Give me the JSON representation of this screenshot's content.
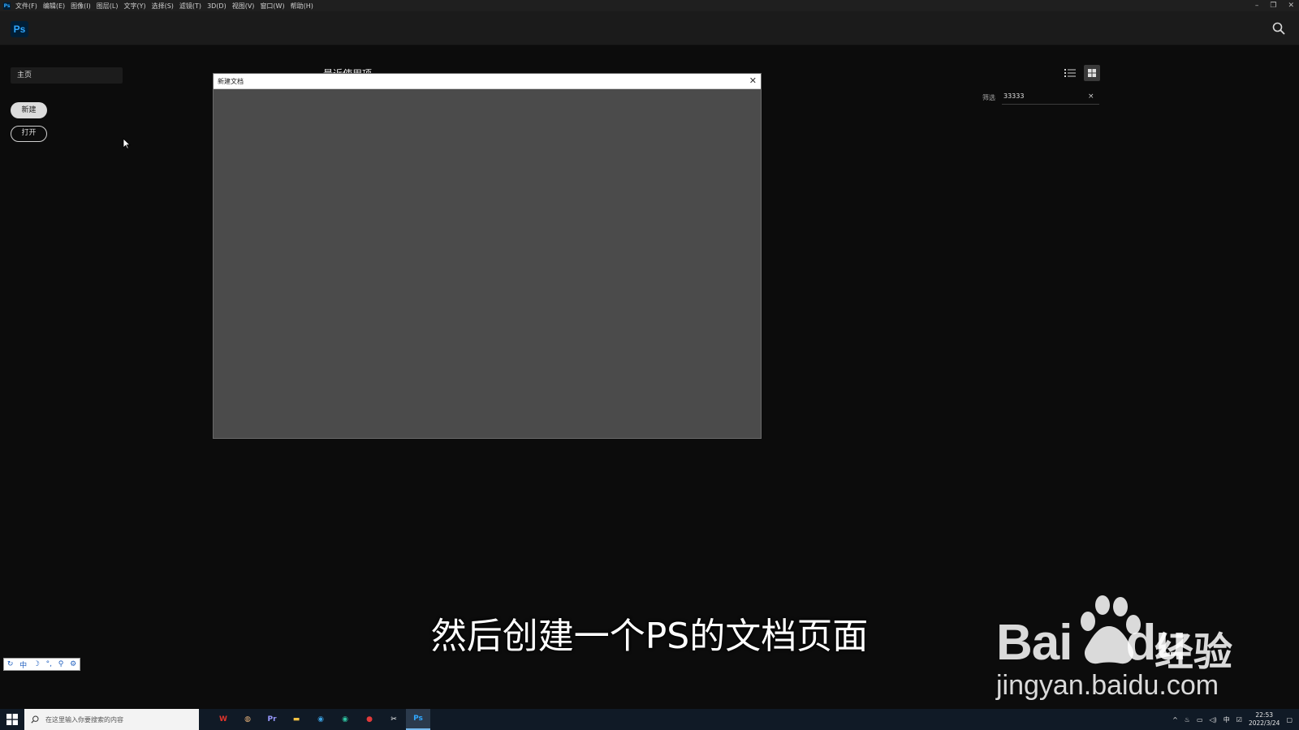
{
  "menubar": {
    "app_icon": "Ps",
    "items": [
      "文件(F)",
      "编辑(E)",
      "图像(I)",
      "图层(L)",
      "文字(Y)",
      "选择(S)",
      "滤镜(T)",
      "3D(D)",
      "视图(V)",
      "窗口(W)",
      "帮助(H)"
    ],
    "window_controls": [
      "–",
      "❐",
      "✕"
    ]
  },
  "appbar": {
    "logo": "Ps",
    "search_icon": "search-icon"
  },
  "left": {
    "home_tab": "主页",
    "new_button": "新建",
    "open_button": "打开"
  },
  "main": {
    "recent_title": "最近使用项"
  },
  "filter": {
    "label": "筛选",
    "value": "33333",
    "clear": "×"
  },
  "dialog": {
    "title": "新建文档",
    "close": "✕"
  },
  "subtitle": "然后创建一个PS的文档页面",
  "watermark": {
    "brand": "Bai",
    "brand_du": "du",
    "cn": "经验",
    "url": "jingyan.baidu.com"
  },
  "ime": {
    "items": [
      "↻",
      "中",
      "☽",
      "°,",
      "⚲",
      "⚙"
    ]
  },
  "taskbar": {
    "search_placeholder": "在这里输入你要搜索的内容",
    "apps": [
      {
        "name": "wps",
        "label": "W",
        "color": "#e0342b"
      },
      {
        "name": "app2",
        "label": "◍",
        "color": "#e7b37a"
      },
      {
        "name": "premiere",
        "label": "Pr",
        "color": "#9999ff"
      },
      {
        "name": "explorer",
        "label": "▬",
        "color": "#f3c343"
      },
      {
        "name": "edge",
        "label": "◉",
        "color": "#3aa0e0"
      },
      {
        "name": "edge2",
        "label": "◉",
        "color": "#2fc3a0"
      },
      {
        "name": "recorder",
        "label": "●",
        "color": "#e23a3a"
      },
      {
        "name": "capcut",
        "label": "✂",
        "color": "#ffffff"
      },
      {
        "name": "photoshop",
        "label": "Ps",
        "color": "#31a8ff"
      }
    ],
    "tray_ime": "中",
    "time": "22:53",
    "date": "2022/3/24"
  }
}
